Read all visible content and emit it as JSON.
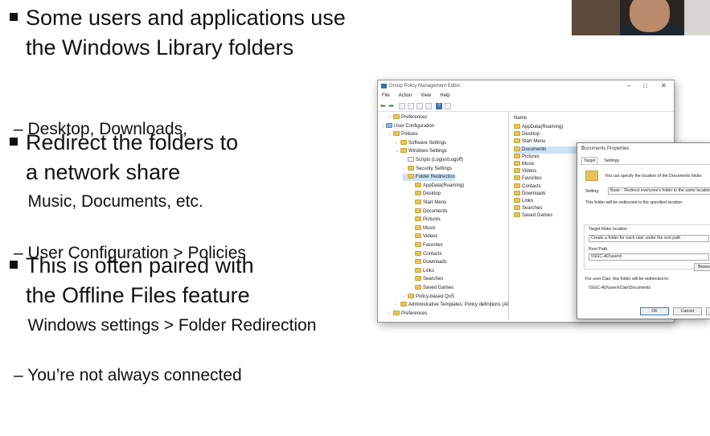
{
  "slide": {
    "bullets": [
      {
        "line1": "Some users and applications use",
        "line2": "the Windows Library folders"
      },
      {
        "line1": "Redirect the folders to",
        "line2": "a network share"
      },
      {
        "line1": "This is often paired with",
        "line2": "the Offline Files feature"
      }
    ],
    "subs": [
      {
        "line1": "– Desktop, Downloads,",
        "line2": "   Music, Documents, etc."
      },
      {
        "line1": "– User Configuration > Policies",
        "line2": "   Windows settings > Folder Redirection"
      },
      {
        "line1": "– You’re not always connected"
      }
    ]
  },
  "gpme": {
    "title": "Group Policy Management Editor",
    "menu": [
      "File",
      "Action",
      "View",
      "Help"
    ],
    "tree": [
      {
        "label": "Preferences",
        "indent": 1,
        "exp": "›",
        "icon": "folder"
      },
      {
        "label": "User Configuration",
        "indent": 0,
        "exp": "⌄",
        "icon": "user"
      },
      {
        "label": "Policies",
        "indent": 1,
        "exp": "⌄",
        "icon": "folder"
      },
      {
        "label": "Software Settings",
        "indent": 2,
        "exp": "›",
        "icon": "folder"
      },
      {
        "label": "Windows Settings",
        "indent": 2,
        "exp": "⌄",
        "icon": "folder"
      },
      {
        "label": "Scripts (Logon/Logoff)",
        "indent": 3,
        "exp": "",
        "icon": "doc"
      },
      {
        "label": "Security Settings",
        "indent": 3,
        "exp": "›",
        "icon": "folder"
      },
      {
        "label": "Folder Redirection",
        "indent": 3,
        "exp": "⌄",
        "icon": "folder",
        "selected": true
      },
      {
        "label": "AppData(Roaming)",
        "indent": 4,
        "exp": "",
        "icon": "folder"
      },
      {
        "label": "Desktop",
        "indent": 4,
        "exp": "",
        "icon": "folder"
      },
      {
        "label": "Start Menu",
        "indent": 4,
        "exp": "",
        "icon": "folder"
      },
      {
        "label": "Documents",
        "indent": 4,
        "exp": "",
        "icon": "folder"
      },
      {
        "label": "Pictures",
        "indent": 4,
        "exp": "",
        "icon": "folder"
      },
      {
        "label": "Music",
        "indent": 4,
        "exp": "",
        "icon": "folder"
      },
      {
        "label": "Videos",
        "indent": 4,
        "exp": "",
        "icon": "folder"
      },
      {
        "label": "Favorites",
        "indent": 4,
        "exp": "",
        "icon": "folder"
      },
      {
        "label": "Contacts",
        "indent": 4,
        "exp": "",
        "icon": "folder"
      },
      {
        "label": "Downloads",
        "indent": 4,
        "exp": "",
        "icon": "folder"
      },
      {
        "label": "Links",
        "indent": 4,
        "exp": "",
        "icon": "folder"
      },
      {
        "label": "Searches",
        "indent": 4,
        "exp": "",
        "icon": "folder"
      },
      {
        "label": "Saved Games",
        "indent": 4,
        "exp": "",
        "icon": "folder"
      },
      {
        "label": "Policy-based QoS",
        "indent": 3,
        "exp": "›",
        "icon": "folder"
      },
      {
        "label": "Administrative Templates: Policy definitions (AD",
        "indent": 2,
        "exp": "›",
        "icon": "folder"
      },
      {
        "label": "Preferences",
        "indent": 1,
        "exp": "›",
        "icon": "folder"
      }
    ],
    "list_header": "Name",
    "list": [
      {
        "label": "AppData(Roaming)"
      },
      {
        "label": "Desktop"
      },
      {
        "label": "Start Menu"
      },
      {
        "label": "Documents",
        "selected": true
      },
      {
        "label": "Pictures"
      },
      {
        "label": "Music"
      },
      {
        "label": "Videos"
      },
      {
        "label": "Favorites"
      },
      {
        "label": "Contacts"
      },
      {
        "label": "Downloads"
      },
      {
        "label": "Links"
      },
      {
        "label": "Searches"
      },
      {
        "label": "Saved Games"
      }
    ]
  },
  "dialog": {
    "title": "Documents Properties",
    "help": "?",
    "tabs": [
      "Target",
      "Settings"
    ],
    "info": "You can specify the location of the Documents folder.",
    "setting_label": "Setting:",
    "setting_value": "Basic - Redirect everyone's folder to the same location",
    "note": "This folder will be redirected to the specified location.",
    "target_label": "Target folder location",
    "target_value": "Create a folder for each user under the root path",
    "root_label": "Root Path:",
    "root_value": "\\\\SGC-AD\\users\\",
    "browse": "Browse...",
    "example": "For user Clair, this folder will be redirected to:",
    "example_path": "\\\\SGC-AD\\users\\Clair\\Documents",
    "ok": "OK",
    "cancel": "Cancel"
  }
}
